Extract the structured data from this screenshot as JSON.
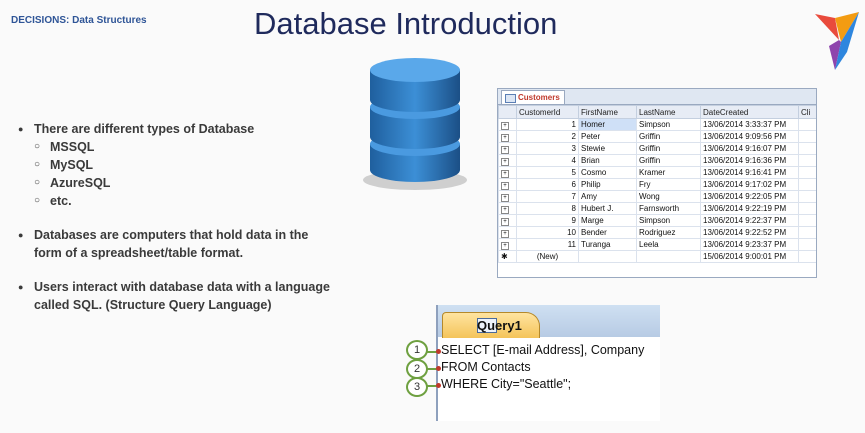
{
  "header": {
    "crumb": "DECISIONS:  Data Structures",
    "title": "Database Introduction"
  },
  "bullets": {
    "b1": "There are different  types of Database",
    "subs": [
      "MSSQL",
      "MySQL",
      "AzureSQL",
      "etc."
    ],
    "b2": "Databases are computers that hold data in the form of a spreadsheet/table format.",
    "b3": "Users interact with database data with a language called SQL. (Structure Query Language)"
  },
  "table": {
    "tab_label": "Customers",
    "headers": [
      "CustomerId",
      "FirstName",
      "LastName",
      "DateCreated",
      "Cli"
    ],
    "rows": [
      [
        "1",
        "Homer",
        "Simpson",
        "13/06/2014 3:33:37 PM"
      ],
      [
        "2",
        "Peter",
        "Griffin",
        "13/06/2014 9:09:56 PM"
      ],
      [
        "3",
        "Stewie",
        "Griffin",
        "13/06/2014 9:16:07 PM"
      ],
      [
        "4",
        "Brian",
        "Griffin",
        "13/06/2014 9:16:36 PM"
      ],
      [
        "5",
        "Cosmo",
        "Kramer",
        "13/06/2014 9:16:41 PM"
      ],
      [
        "6",
        "Philip",
        "Fry",
        "13/06/2014 9:17:02 PM"
      ],
      [
        "7",
        "Amy",
        "Wong",
        "13/06/2014 9:22:05 PM"
      ],
      [
        "8",
        "Hubert J.",
        "Farnsworth",
        "13/06/2014 9:22:19 PM"
      ],
      [
        "9",
        "Marge",
        "Simpson",
        "13/06/2014 9:22:37 PM"
      ],
      [
        "10",
        "Bender",
        "Rodriguez",
        "13/06/2014 9:22:52 PM"
      ],
      [
        "11",
        "Turanga",
        "Leela",
        "13/06/2014 9:23:37 PM"
      ]
    ],
    "new_row": [
      "(New)",
      "",
      "",
      "15/06/2014 9:00:01 PM"
    ]
  },
  "query": {
    "tab_label": "Query1",
    "lines": [
      "SELECT [E-mail Address], Company",
      "FROM Contacts",
      "WHERE City=\"Seattle\";"
    ],
    "numbers": [
      "1",
      "2",
      "3"
    ]
  }
}
